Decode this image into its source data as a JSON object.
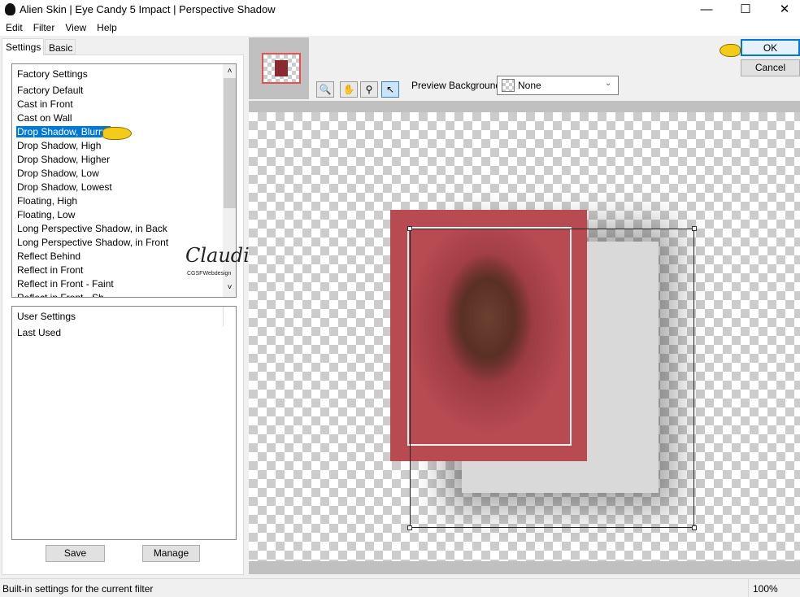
{
  "window": {
    "title": "Alien Skin | Eye Candy 5 Impact | Perspective Shadow",
    "minimize": "—",
    "maximize": "☐",
    "close": "✕"
  },
  "menu": [
    "Edit",
    "Filter",
    "View",
    "Help"
  ],
  "tabs": [
    "Settings",
    "Basic"
  ],
  "factory": {
    "header": "Factory Settings",
    "selected": "Drop Shadow, Blurry",
    "items": [
      "Factory Default",
      "Cast in Front",
      "Cast on Wall",
      "Drop Shadow, Blurry",
      "Drop Shadow, High",
      "Drop Shadow, Higher",
      "Drop Shadow, Low",
      "Drop Shadow, Lowest",
      "Floating, High",
      "Floating, Low",
      "Long Perspective Shadow, in Back",
      "Long Perspective Shadow, in Front",
      "Reflect Behind",
      "Reflect in Front",
      "Reflect in Front - Faint",
      "Reflect in Front - Sh"
    ]
  },
  "user": {
    "header": "User Settings",
    "items": [
      "Last Used"
    ]
  },
  "buttons": {
    "save": "Save",
    "manage": "Manage",
    "ok": "OK",
    "cancel": "Cancel"
  },
  "preview": {
    "background_label": "Preview Background:",
    "background_value": "None"
  },
  "watermark": {
    "name": "Claudia",
    "sub": "CGSFWebdesign"
  },
  "status": {
    "text": "Built-in settings for the current filter",
    "zoom": "100%"
  },
  "colors": {
    "selection": "#0078d7",
    "image_red": "#b84a52"
  }
}
